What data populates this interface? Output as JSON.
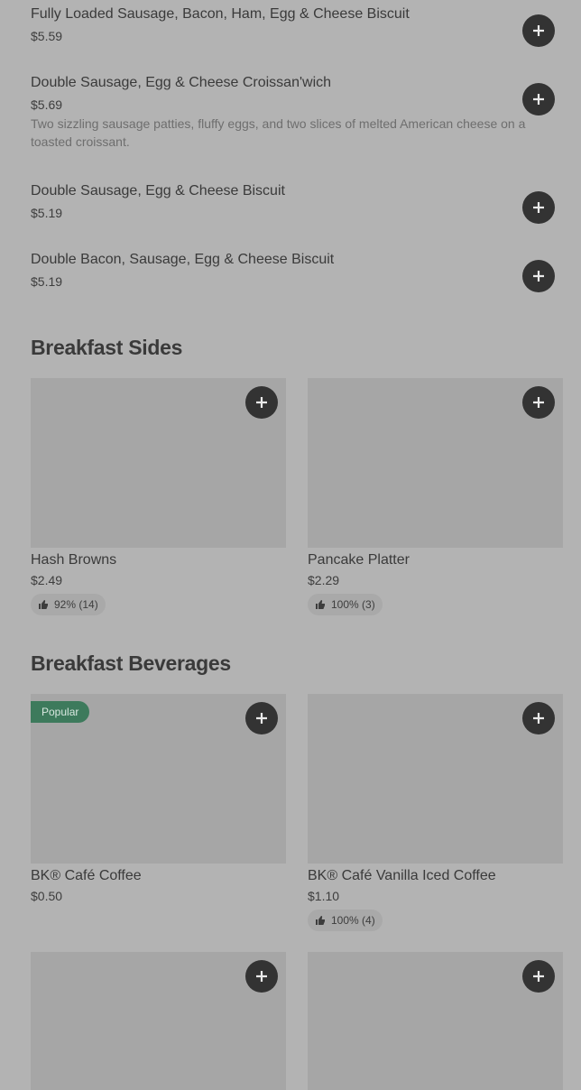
{
  "menu_items": [
    {
      "name": "Fully Loaded Sausage, Bacon, Ham, Egg & Cheese Biscuit",
      "price": "$5.59"
    },
    {
      "name": "Double Sausage, Egg & Cheese Croissan'wich",
      "price": "$5.69",
      "description": "Two sizzling sausage patties, fluffy eggs, and two slices of melted American cheese on a toasted croissant."
    },
    {
      "name": "Double Sausage, Egg & Cheese Biscuit",
      "price": "$5.19"
    },
    {
      "name": "Double Bacon, Sausage, Egg & Cheese Biscuit",
      "price": "$5.19"
    }
  ],
  "sections": {
    "breakfast_sides": {
      "title": "Breakfast Sides",
      "cards": [
        {
          "name": "Hash Browns",
          "price": "$2.49",
          "rating": "92% (14)"
        },
        {
          "name": "Pancake Platter",
          "price": "$2.29",
          "rating": "100% (3)"
        }
      ]
    },
    "breakfast_beverages": {
      "title": "Breakfast Beverages",
      "cards": [
        {
          "name": "BK® Café Coffee",
          "price": "$0.50",
          "badge": "Popular"
        },
        {
          "name": "BK® Café Vanilla Iced Coffee",
          "price": "$1.10",
          "rating": "100% (4)"
        }
      ]
    }
  },
  "icons": {
    "add": "plus-icon",
    "rating": "thumbs-up-icon"
  },
  "colors": {
    "background": "#b3b3b3",
    "button": "#333333",
    "badge": "#3d7a5c",
    "image_placeholder": "#a6a6a6"
  }
}
